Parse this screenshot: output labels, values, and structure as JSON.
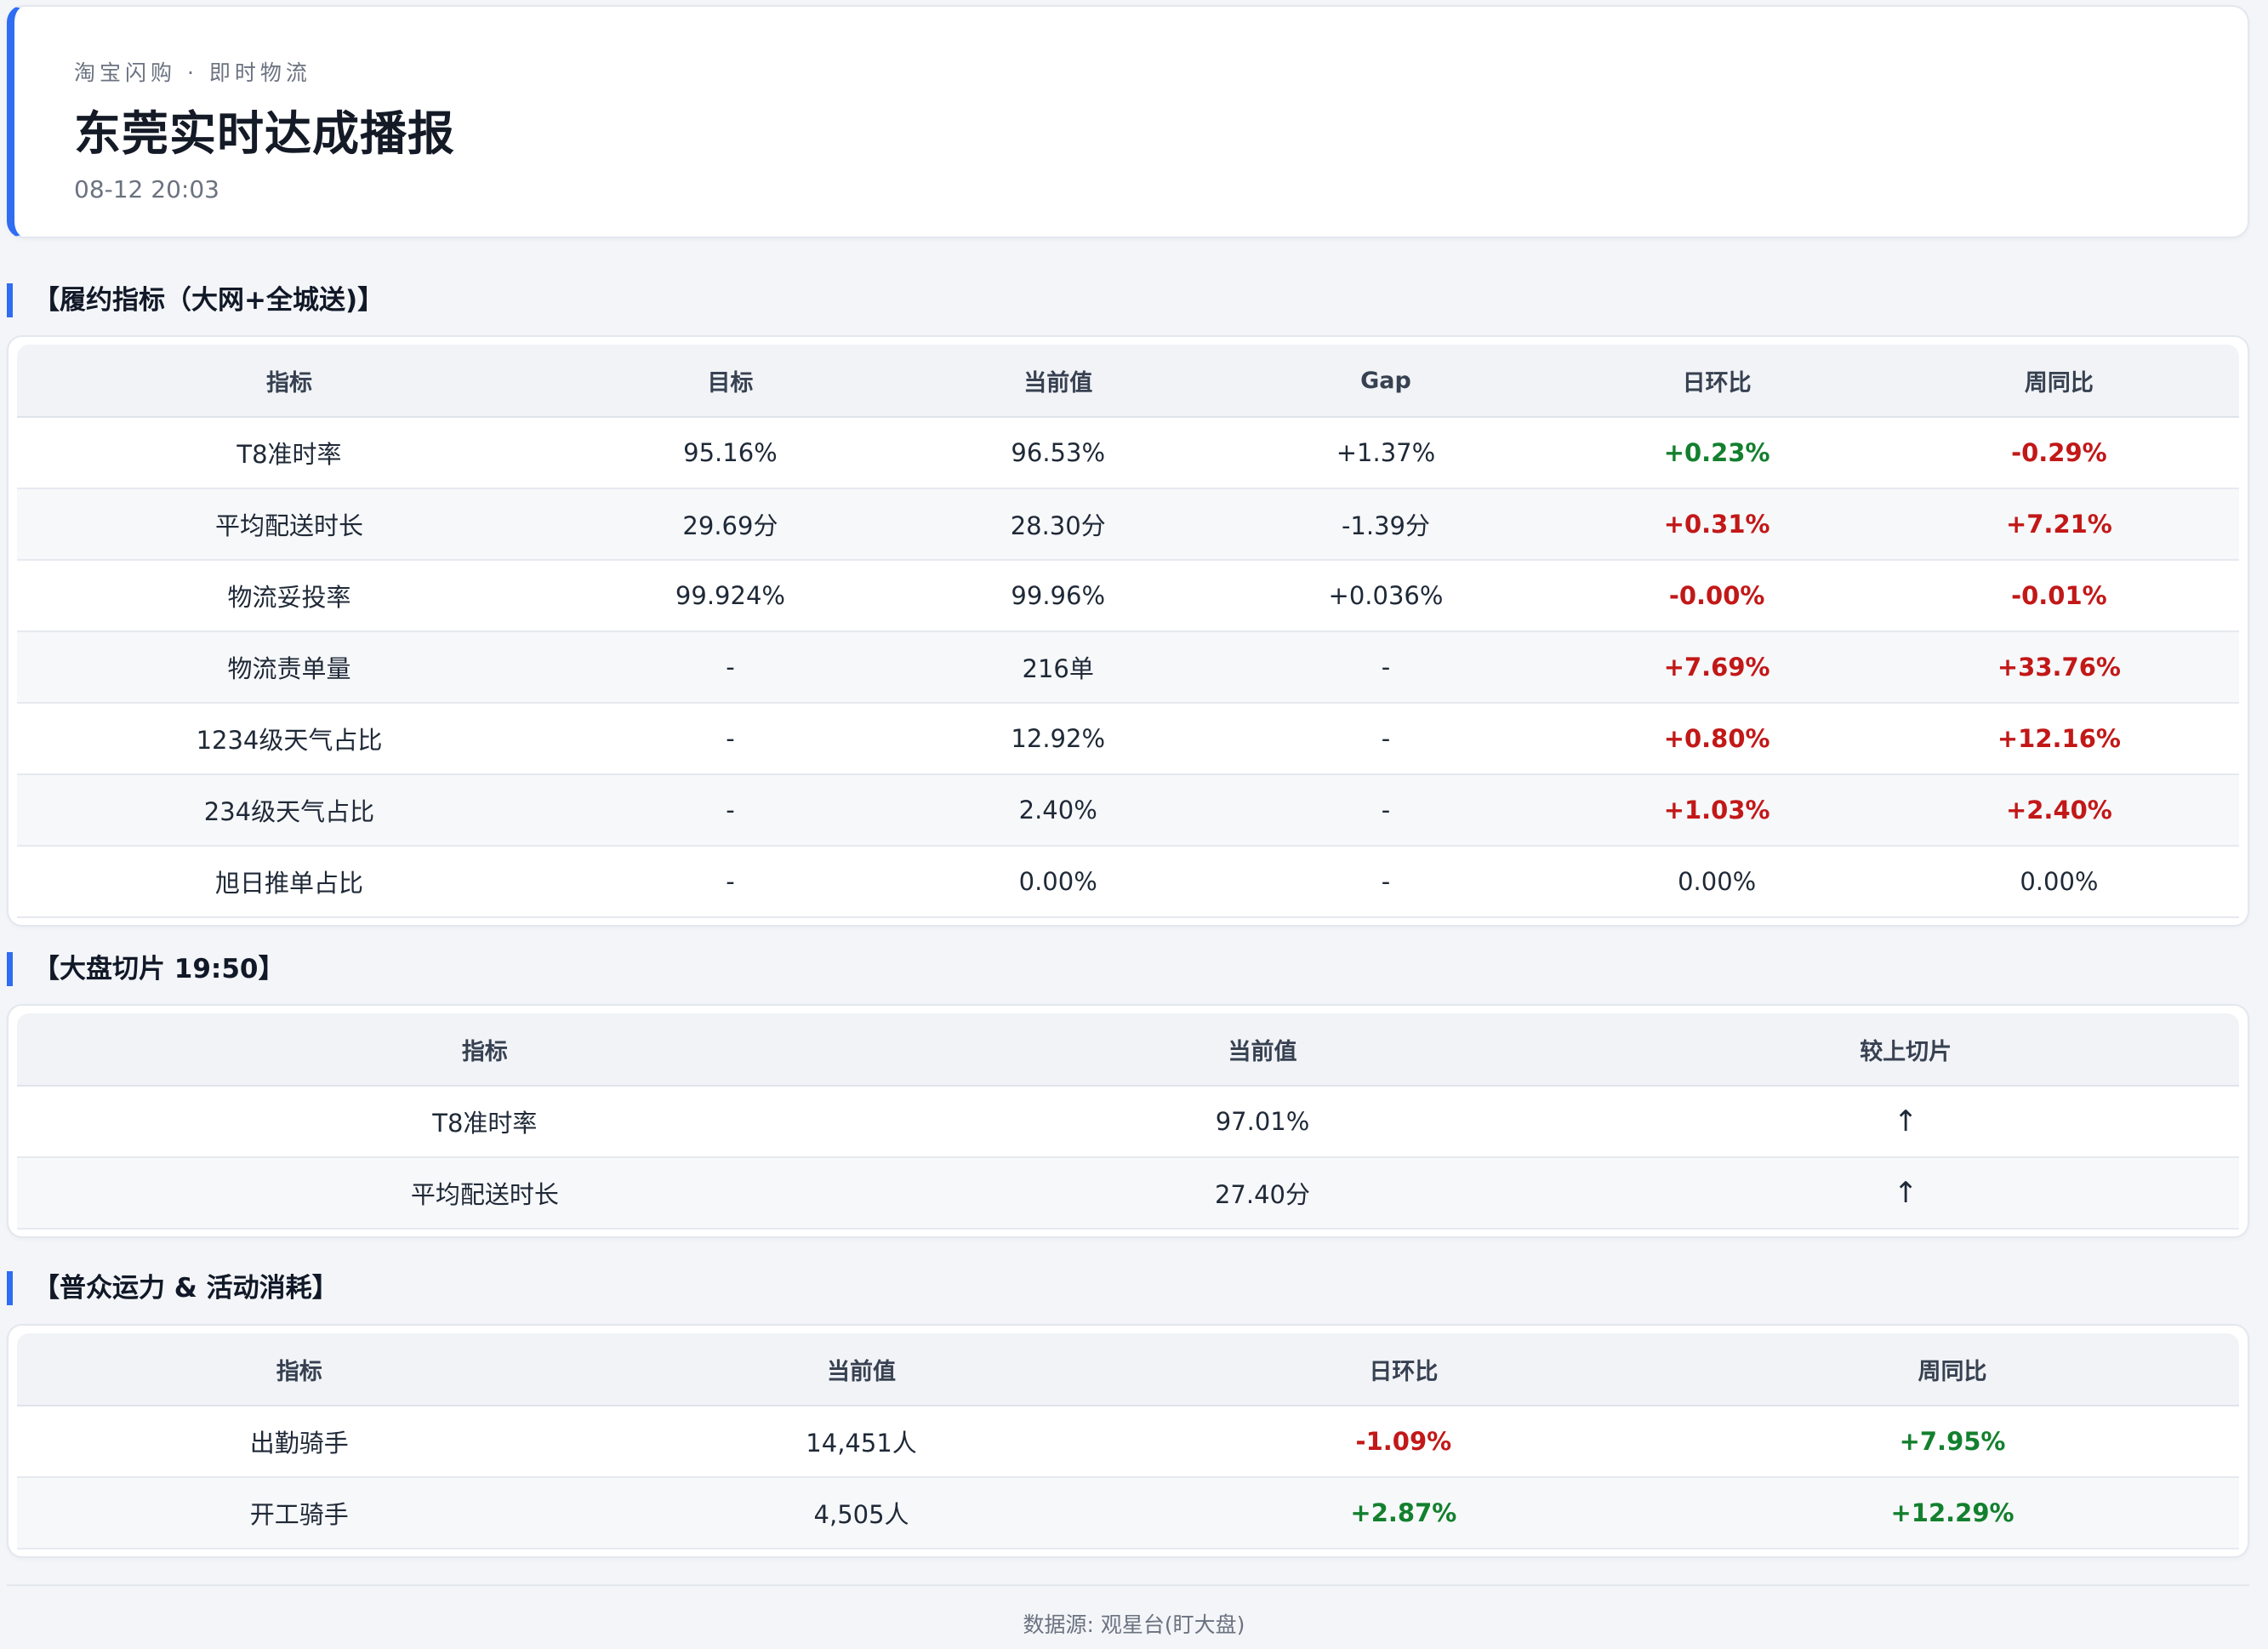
{
  "header": {
    "subtitle": "淘宝闪购 · 即时物流",
    "title": "东莞实时达成播报",
    "timestamp": "08-12 20:03"
  },
  "sections": [
    {
      "title": "【履约指标（大网+全城送)】",
      "columns": [
        "指标",
        "目标",
        "当前值",
        "Gap",
        "日环比",
        "周同比"
      ],
      "rows": [
        [
          "T8准时率",
          "95.16%",
          "96.53%",
          "+1.37%",
          "+0.23%",
          "-0.29%"
        ],
        [
          "平均配送时长",
          "29.69分",
          "28.30分",
          "-1.39分",
          "+0.31%",
          "+7.21%"
        ],
        [
          "物流妥投率",
          "99.924%",
          "99.96%",
          "+0.036%",
          "-0.00%",
          "-0.01%"
        ],
        [
          "物流责单量",
          "-",
          "216单",
          "-",
          "+7.69%",
          "+33.76%"
        ],
        [
          "1234级天气占比",
          "-",
          "12.92%",
          "-",
          "+0.80%",
          "+12.16%"
        ],
        [
          "234级天气占比",
          "-",
          "2.40%",
          "-",
          "+1.03%",
          "+2.40%"
        ],
        [
          "旭日推单占比",
          "-",
          "0.00%",
          "-",
          "0.00%",
          "0.00%"
        ]
      ],
      "cell_tones": [
        [
          "",
          "",
          "",
          "",
          "up",
          "down"
        ],
        [
          "",
          "",
          "",
          "",
          "down",
          "down"
        ],
        [
          "",
          "",
          "",
          "",
          "down",
          "down"
        ],
        [
          "",
          "",
          "",
          "",
          "down",
          "down"
        ],
        [
          "",
          "",
          "",
          "",
          "down",
          "down"
        ],
        [
          "",
          "",
          "",
          "",
          "down",
          "down"
        ],
        [
          "",
          "",
          "",
          "",
          "",
          ""
        ]
      ]
    },
    {
      "title": "【大盘切片 19:50】",
      "columns": [
        "指标",
        "当前值",
        "较上切片"
      ],
      "rows": [
        [
          "T8准时率",
          "97.01%",
          "↑"
        ],
        [
          "平均配送时长",
          "27.40分",
          "↑"
        ]
      ],
      "cell_tones": [
        [
          "",
          "",
          "arrow"
        ],
        [
          "",
          "",
          "arrow"
        ]
      ]
    },
    {
      "title": "【普众运力 & 活动消耗】",
      "columns": [
        "指标",
        "当前值",
        "日环比",
        "周同比"
      ],
      "rows": [
        [
          "出勤骑手",
          "14,451人",
          "-1.09%",
          "+7.95%"
        ],
        [
          "开工骑手",
          "4,505人",
          "+2.87%",
          "+12.29%"
        ]
      ],
      "cell_tones": [
        [
          "",
          "",
          "down",
          "up"
        ],
        [
          "",
          "",
          "up",
          "up"
        ]
      ]
    }
  ],
  "footer": {
    "source": "数据源: 观星台(盯大盘)"
  },
  "colors": {
    "accent": "#2f6df2",
    "positive": "#13802e",
    "negative": "#c21818"
  }
}
